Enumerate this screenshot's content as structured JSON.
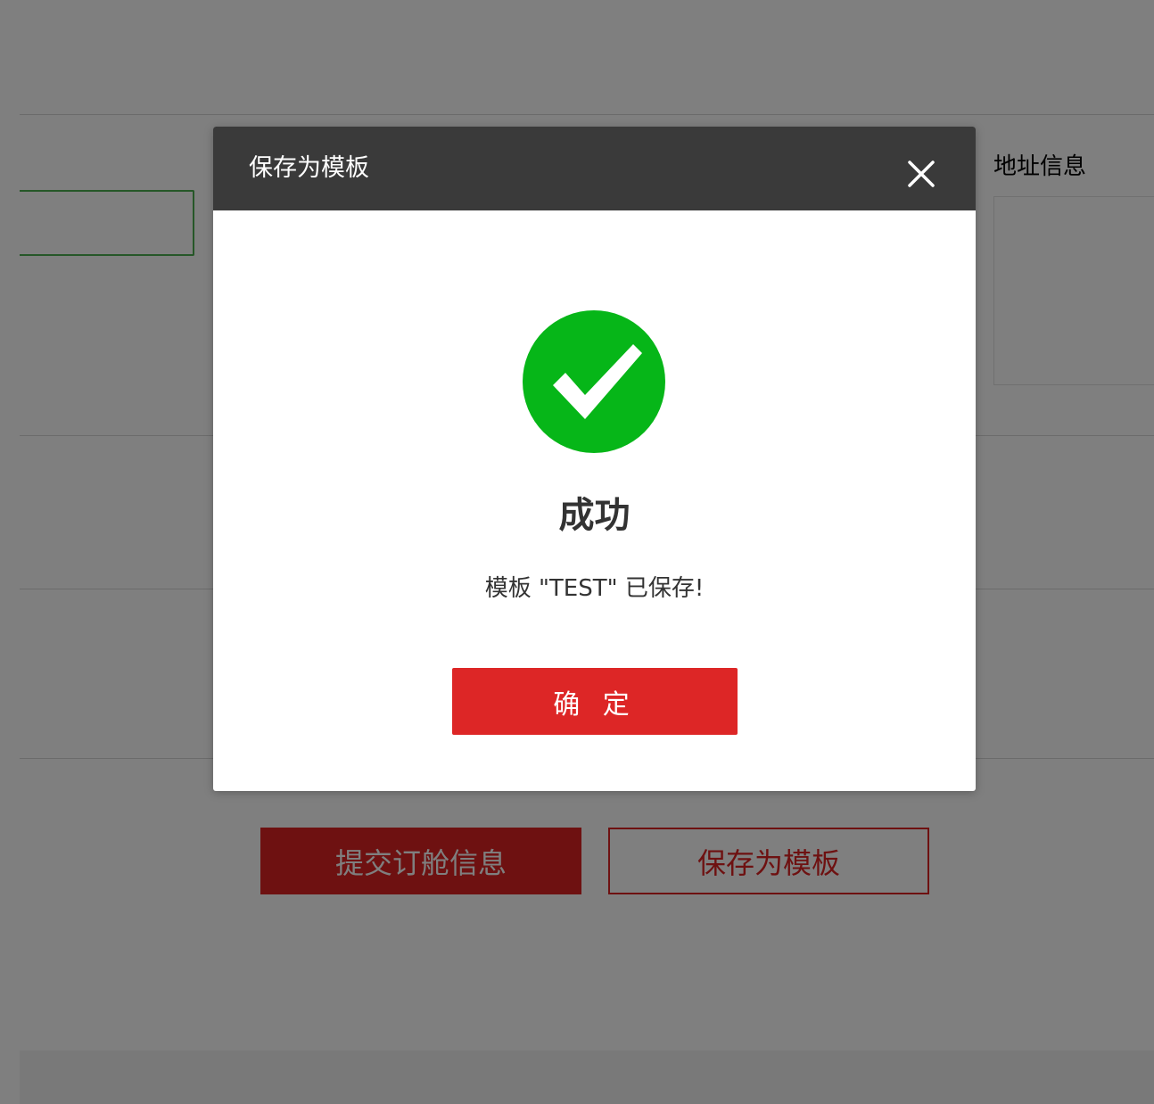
{
  "background": {
    "address_label": "地址信息",
    "submit_button": "提交订舱信息",
    "save_template_button": "保存为模板"
  },
  "modal": {
    "title": "保存为模板",
    "close_icon": "close-icon",
    "status_icon": "check-circle-icon",
    "status_title": "成功",
    "message": "模板 \"TEST\" 已保存!",
    "ok_button": "确 定"
  },
  "colors": {
    "overlay": "rgba(0,0,0,0.5)",
    "header": "#3a3a3a",
    "success_green": "#06b618",
    "primary_red": "#dd2626"
  }
}
